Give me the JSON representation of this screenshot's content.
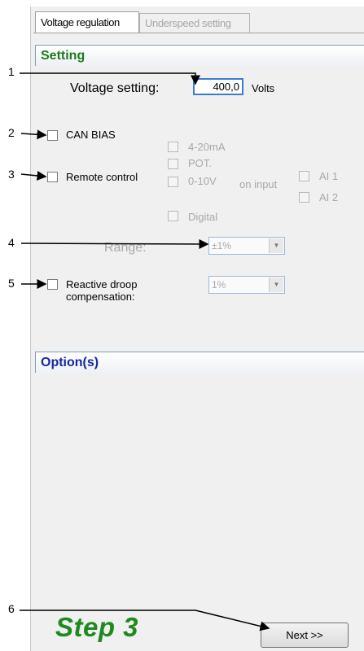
{
  "tabs": [
    {
      "label": "Voltage regulation",
      "active": true
    },
    {
      "label": "Underspeed setting",
      "active": false
    }
  ],
  "sections": {
    "setting": "Setting",
    "options": "Option(s)"
  },
  "voltage": {
    "label": "Voltage setting:",
    "value": "400,0",
    "unit": "Volts"
  },
  "can_bias": {
    "label": "CAN BIAS",
    "checked": false
  },
  "remote_control": {
    "label": "Remote control",
    "checked": false,
    "sources": [
      "4-20mA",
      "POT.",
      "0-10V",
      "Digital"
    ],
    "on_input_label": "on input",
    "inputs": [
      "AI 1",
      "AI 2"
    ]
  },
  "range": {
    "label": "Range:",
    "value": "±1%"
  },
  "reactive_droop": {
    "label_line1": "Reactive droop",
    "label_line2": "compensation:",
    "checked": false,
    "value": "1%"
  },
  "callouts": [
    "1",
    "2",
    "3",
    "4",
    "5",
    "6"
  ],
  "step_label": "Step 3",
  "next_button": "Next >>",
  "colors": {
    "setting_header": "#1e7b1e",
    "options_header": "#1428a0",
    "step_text": "#1e8a1e",
    "input_focus": "#3a7bd5"
  }
}
